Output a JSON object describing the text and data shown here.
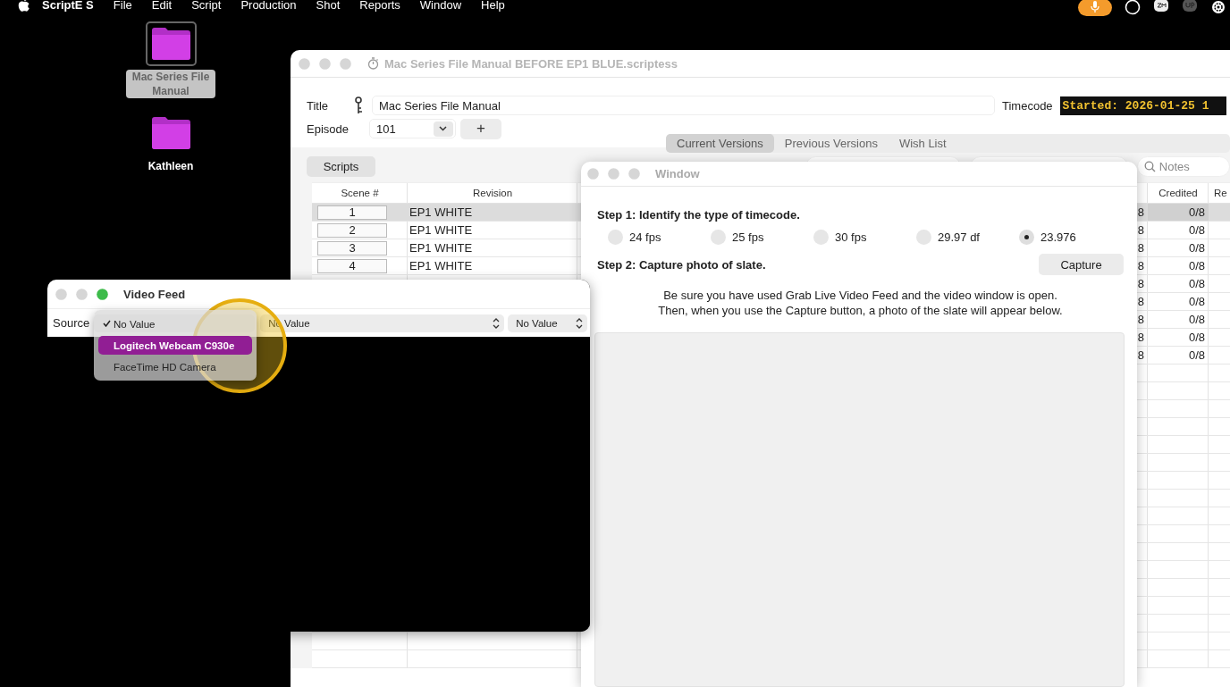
{
  "menu_bar": {
    "app_name": "ScriptE S",
    "menus": [
      "File",
      "Edit",
      "Script",
      "Production",
      "Shot",
      "Reports",
      "Window",
      "Help"
    ]
  },
  "desktop_icons": [
    {
      "label": "Mac Series File Manual",
      "selected": true
    },
    {
      "label": "Kathleen",
      "selected": false
    }
  ],
  "main_window": {
    "title": "Mac Series File Manual BEFORE EP1 BLUE.scriptess",
    "title_label": "Title",
    "title_value": "Mac Series File Manual",
    "timecode_label": "Timecode",
    "timecode_value": "Started: 2026-01-25 1",
    "episode_label": "Episode",
    "episode_value": "101",
    "add_button": "+",
    "tabs": [
      {
        "label": "Current Versions",
        "selected": true
      },
      {
        "label": "Previous Versions",
        "selected": false
      },
      {
        "label": "Wish List",
        "selected": false
      }
    ],
    "scripts_button": "Scripts",
    "search_placeholder": "Notes",
    "table": {
      "columns": [
        "Scene #",
        "Revision",
        "Credited",
        "Re"
      ],
      "rows": [
        {
          "scene": "1",
          "revision": "EP1 WHITE",
          "column_3": "8",
          "credited": "0/8",
          "selected": true
        },
        {
          "scene": "2",
          "revision": "EP1 WHITE",
          "column_3": "8",
          "credited": "0/8",
          "selected": false
        },
        {
          "scene": "3",
          "revision": "EP1 WHITE",
          "column_3": "8",
          "credited": "0/8",
          "selected": false
        },
        {
          "scene": "4",
          "revision": "EP1 WHITE",
          "column_3": "8",
          "credited": "0/8",
          "selected": false
        },
        {
          "column_3": "8",
          "credited": "0/8",
          "selected": false
        },
        {
          "column_3": "8",
          "credited": "0/8",
          "selected": false
        },
        {
          "column_3": "8",
          "credited": "0/8",
          "selected": false
        },
        {
          "column_3": "8",
          "credited": "0/8",
          "selected": false
        },
        {
          "column_3": "8",
          "credited": "0/8",
          "selected": false
        }
      ]
    }
  },
  "timecode_dialog": {
    "title": "Window",
    "step_1": "Step 1: Identify the type of timecode.",
    "rates": [
      {
        "label": "24 fps",
        "selected": false
      },
      {
        "label": "25 fps",
        "selected": false
      },
      {
        "label": "30 fps",
        "selected": false
      },
      {
        "label": "29.97 df",
        "selected": false
      },
      {
        "label": "23.976",
        "selected": true
      }
    ],
    "step_2": "Step 2: Capture photo of slate.",
    "capture_button": "Capture",
    "instructions": [
      "Be sure you have used Grab Live Video Feed and the video window is open.",
      "Then, when you use the Capture button, a photo of the slate will appear below."
    ]
  },
  "video_feed": {
    "title": "Video Feed",
    "source_label": "Source",
    "source_menu": [
      {
        "label": "No Value",
        "checked": true,
        "selected": false
      },
      {
        "label": "Logitech Webcam C930e",
        "checked": false,
        "selected": true
      },
      {
        "label": "FaceTime HD Camera",
        "checked": false,
        "selected": false
      }
    ],
    "popup_2": "No Value",
    "popup_3": "No Value"
  }
}
